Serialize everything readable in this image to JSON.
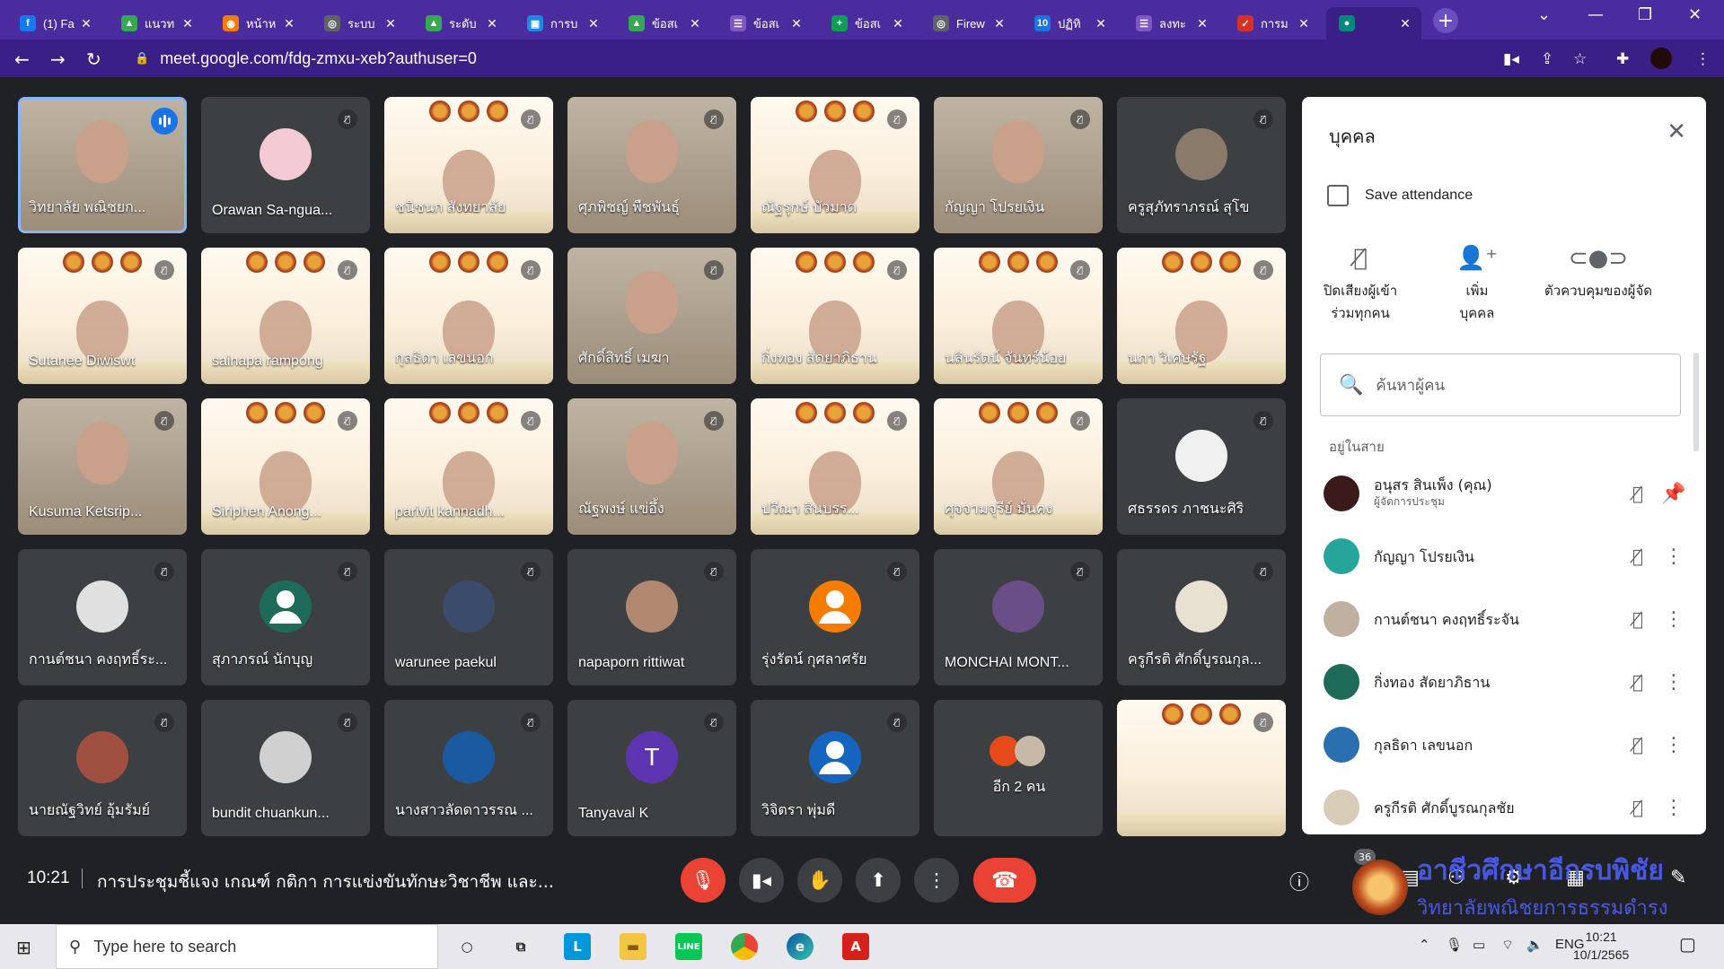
{
  "browser": {
    "tabs": [
      {
        "title": "(1) Fa",
        "icon": "facebook-icon",
        "color": "#1877f2",
        "glyph": "f"
      },
      {
        "title": "แนวท",
        "icon": "drive-icon",
        "color": "#34a853",
        "glyph": "▲"
      },
      {
        "title": "หน้าห",
        "icon": "site-icon",
        "color": "#f57c00",
        "glyph": "◉"
      },
      {
        "title": "ระบบ",
        "icon": "globe-icon",
        "color": "#5f6368",
        "glyph": "◎"
      },
      {
        "title": "ระดับ",
        "icon": "drive-icon",
        "color": "#34a853",
        "glyph": "▲"
      },
      {
        "title": "การบ",
        "icon": "classroom-icon",
        "color": "#1e88e5",
        "glyph": "▣"
      },
      {
        "title": "ข้อสเ",
        "icon": "drive-icon",
        "color": "#34a853",
        "glyph": "▲"
      },
      {
        "title": "ข้อสเ",
        "icon": "forms-icon",
        "color": "#7e57c2",
        "glyph": "☰"
      },
      {
        "title": "ข้อสเ",
        "icon": "sheets-icon",
        "color": "#0f9d58",
        "glyph": "+"
      },
      {
        "title": "Firew",
        "icon": "globe-icon",
        "color": "#5f6368",
        "glyph": "◎"
      },
      {
        "title": "ปฏิทิ",
        "icon": "calendar-icon",
        "color": "#1a73e8",
        "glyph": "10"
      },
      {
        "title": "ลงทะ",
        "icon": "forms-icon",
        "color": "#7e57c2",
        "glyph": "☰"
      },
      {
        "title": "การม",
        "icon": "check-icon",
        "color": "#d93025",
        "glyph": "✓"
      },
      {
        "title": "",
        "icon": "meet-icon",
        "color": "#00897b",
        "glyph": "●"
      }
    ],
    "url": "meet.google.com/fdg-zmxu-xeb?authuser=0"
  },
  "tiles": [
    {
      "name": "วิทยาลัย พณิชยก...",
      "kind": "speaking"
    },
    {
      "name": "Orawan Sa-ngua...",
      "kind": "avatar",
      "avcolor": "#f3c9d3"
    },
    {
      "name": "ชนิชนก สังทยาลัย",
      "kind": "cert"
    },
    {
      "name": "ศุภพิชญ์ พืชพันธุ์",
      "kind": "photo"
    },
    {
      "name": "ณัฐรุกษ์ บัวมาด",
      "kind": "cert"
    },
    {
      "name": "กัญญา โปรยเงิน",
      "kind": "photo"
    },
    {
      "name": "ครูสุภัทราภรณ์ สุโข",
      "kind": "avatar",
      "avcolor": "#8a7a6a"
    },
    {
      "name": "Sutanee Diwiswt",
      "kind": "cert"
    },
    {
      "name": "sainapa rampong",
      "kind": "cert"
    },
    {
      "name": "กุลธิดา เลขนอก",
      "kind": "cert"
    },
    {
      "name": "ศักดิ์สิทธิ์ เมฆา",
      "kind": "photo"
    },
    {
      "name": "กิ่งทอง สัดยาภิธาน",
      "kind": "cert"
    },
    {
      "name": "นลินรัตน์ จันทร์น้อย",
      "kind": "cert"
    },
    {
      "name": "นภา วิเศษรัฐ",
      "kind": "cert"
    },
    {
      "name": "Kusuma Ketsrip...",
      "kind": "photo"
    },
    {
      "name": "Siriphen Anong...",
      "kind": "cert"
    },
    {
      "name": "parivit kannadh...",
      "kind": "cert"
    },
    {
      "name": "ณัฐพงษ์ แข่อึ้ง",
      "kind": "photo"
    },
    {
      "name": "ปวีณา สินบรร...",
      "kind": "cert"
    },
    {
      "name": "ศุจจามจุรีย์ มั่นคง",
      "kind": "cert"
    },
    {
      "name": "ศธรรดร ภาชนะศิริ",
      "kind": "avatar",
      "avcolor": "#f0f0f0"
    },
    {
      "name": "กานต์ชนา คงฤทธิ์ระ...",
      "kind": "avatar",
      "avcolor": "#e0e0e0"
    },
    {
      "name": "สุภาภรณ์ นักบุญ",
      "kind": "avatar-person",
      "avcolor": "#1e6b5a"
    },
    {
      "name": "warunee paekul",
      "kind": "avatar",
      "avcolor": "#3b4b6b"
    },
    {
      "name": "napaporn rittiwat",
      "kind": "avatar",
      "avcolor": "#b08870"
    },
    {
      "name": "รุ่งรัตน์ กุศลาศรัย",
      "kind": "avatar-person",
      "avcolor": "#f57c00"
    },
    {
      "name": "MONCHAI MONT...",
      "kind": "avatar",
      "avcolor": "#6a4e88"
    },
    {
      "name": "ครูกีรติ ศักดิ์บูรณกุล...",
      "kind": "avatar",
      "avcolor": "#e8e0d0"
    },
    {
      "name": "นายณัฐวิทย์ อุ้มรัมย์",
      "kind": "avatar",
      "avcolor": "#a05040"
    },
    {
      "name": "bundit chuankun...",
      "kind": "avatar",
      "avcolor": "#d0d0d0"
    },
    {
      "name": "นางสาวลัดดาวรรณ ...",
      "kind": "avatar",
      "avcolor": "#1a5aa0"
    },
    {
      "name": "Tanyaval K",
      "kind": "letter",
      "letter": "T",
      "avcolor": "#5e35b1"
    },
    {
      "name": "วิจิตรา พุ่มดี",
      "kind": "avatar-person",
      "avcolor": "#1565c0"
    },
    {
      "name": "อีก 2 คน",
      "kind": "more"
    },
    {
      "name": "",
      "kind": "presentation"
    }
  ],
  "panel": {
    "title": "บุคคล",
    "save_attendance": "Save attendance",
    "actions": [
      {
        "label": "ปิดเสียงผู้เข้าร่วมทุกคน",
        "icon": "mic-off-icon"
      },
      {
        "label": "เพิ่มบุคคล",
        "icon": "person-add-icon"
      },
      {
        "label": "ตัวควบคุมของผู้จัด",
        "icon": "toggle-icon"
      }
    ],
    "search_placeholder": "ค้นหาผู้คน",
    "section": "อยู่ในสาย",
    "people": [
      {
        "name": "อนุสร สินเพ็ง (คุณ)",
        "sub": "ผู้จัดการประชุม",
        "avcolor": "#3a1a1a",
        "action": "pin-icon"
      },
      {
        "name": "กัญญา โปรยเงิน",
        "sub": "",
        "avcolor": "#26a69a",
        "action": "more-icon"
      },
      {
        "name": "กานต์ชนา คงฤทธิ์ระจัน",
        "sub": "",
        "avcolor": "#c0b0a0",
        "action": "more-icon"
      },
      {
        "name": "กิ่งทอง สัดยาภิธาน",
        "sub": "",
        "avcolor": "#1e6b5a",
        "action": "more-icon"
      },
      {
        "name": "กุลธิดา เลขนอก",
        "sub": "",
        "avcolor": "#2a6fb0",
        "action": "more-icon"
      },
      {
        "name": "ครูกีรติ ศักดิ์บูรณกุลชัย",
        "sub": "",
        "avcolor": "#d8ccb8",
        "action": "more-icon"
      }
    ]
  },
  "bottom": {
    "time": "10:21",
    "meeting_title": "การประชุมชี้แจง เกณฑ์ กติกา การแข่งขันทักษะวิชาชีพ และ...",
    "participants_count": "36",
    "watermark_title": "อาชีวศึกษาอีกรบพิชัย",
    "watermark_sub": "วิทยาลัยพณิชยการธรรมดำรง"
  },
  "taskbar": {
    "search_placeholder": "Type here to search",
    "lang": "ENG",
    "clock_time": "10:21",
    "clock_date": "10/1/2565"
  }
}
